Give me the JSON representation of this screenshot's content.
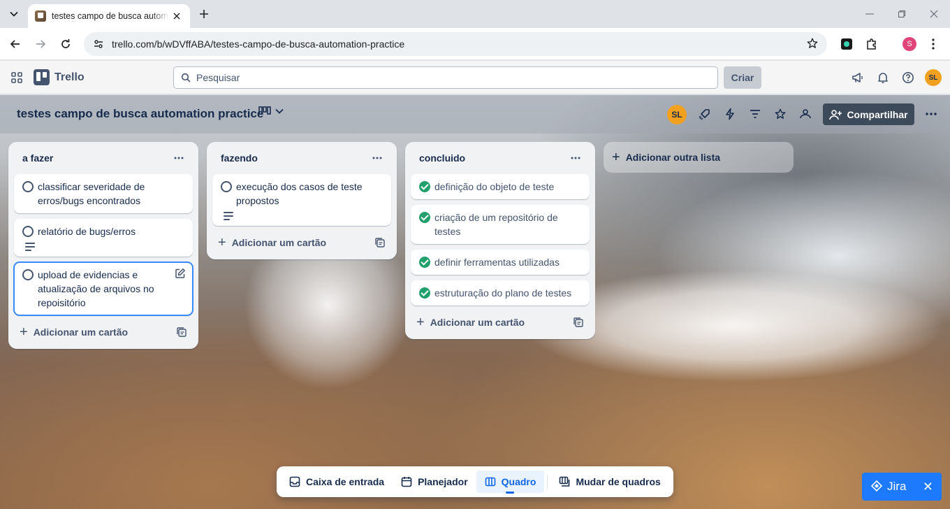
{
  "browser": {
    "tab_title": "testes campo de busca automation practice",
    "url": "trello.com/b/wDVffABA/testes-campo-de-busca-automation-practice",
    "profile_initial": "S"
  },
  "header": {
    "app_name": "Trello",
    "search_placeholder": "Pesquisar",
    "create_label": "Criar",
    "avatar_initials": "SL"
  },
  "board": {
    "title": "testes campo de busca automation practice",
    "member_initials": "SL",
    "share_label": "Compartilhar",
    "add_list_label": "Adicionar outra lista"
  },
  "lists": [
    {
      "title": "a fazer",
      "cards": [
        {
          "text": "classificar severidade de erros/bugs encontrados",
          "done": false,
          "has_description": false
        },
        {
          "text": "relatório de bugs/erros",
          "done": false,
          "has_description": true
        },
        {
          "text": "upload de evidencias e atualização de arquivos no repoisitório",
          "done": false,
          "has_description": false
        }
      ],
      "add_card_label": "Adicionar um cartão"
    },
    {
      "title": "fazendo",
      "cards": [
        {
          "text": "execução dos casos de teste propostos",
          "done": false,
          "has_description": true
        }
      ],
      "add_card_label": "Adicionar um cartão"
    },
    {
      "title": "concluido",
      "cards": [
        {
          "text": "definição do objeto de teste",
          "done": true
        },
        {
          "text": "criação de um repositório de testes",
          "done": true
        },
        {
          "text": "definir ferramentas utilizadas",
          "done": true
        },
        {
          "text": "estruturação do plano de testes",
          "done": true
        }
      ],
      "add_card_label": "Adicionar um cartão"
    }
  ],
  "bottom_nav": {
    "inbox": "Caixa de entrada",
    "planner": "Planejador",
    "board": "Quadro",
    "switch": "Mudar de quadros"
  },
  "jira": {
    "label": "Jira",
    "close": "✕"
  },
  "colors": {
    "accent": "#0c66e4",
    "done_green": "#22a06b",
    "avatar_orange": "#f2a01f",
    "share_dark": "#3d4a5a"
  }
}
